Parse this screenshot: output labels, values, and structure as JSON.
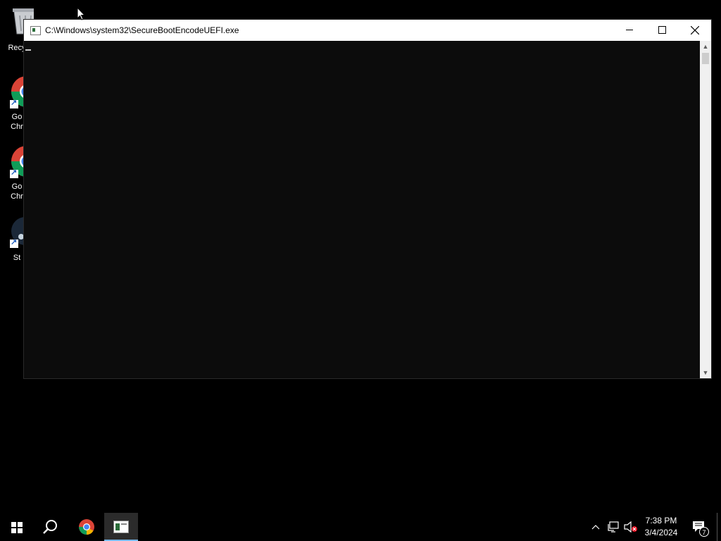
{
  "desktop": {
    "icons": [
      {
        "label": "Recy",
        "icon": "recycle-bin-icon"
      },
      {
        "label": "Go Chr",
        "line1": "Go",
        "line2": "Chr",
        "icon": "chrome-icon"
      },
      {
        "label": "Go Chr",
        "line1": "Go",
        "line2": "Chr",
        "icon": "chrome-icon"
      },
      {
        "label": "St",
        "icon": "steam-icon"
      }
    ]
  },
  "window": {
    "title": "C:\\Windows\\system32\\SecureBootEncodeUEFI.exe",
    "console_output": "_"
  },
  "taskbar": {
    "items": [
      "start-icon",
      "search-icon",
      "chrome-icon",
      "console-icon"
    ],
    "clock": {
      "time": "7:38 PM",
      "date": "3/4/2024"
    },
    "notification_count": "7"
  },
  "colors": {
    "console_bg": "#0c0c0c",
    "titlebar_bg": "#ffffff",
    "taskbar_bg": "#000000",
    "active_task_indicator": "#76b9ed"
  }
}
